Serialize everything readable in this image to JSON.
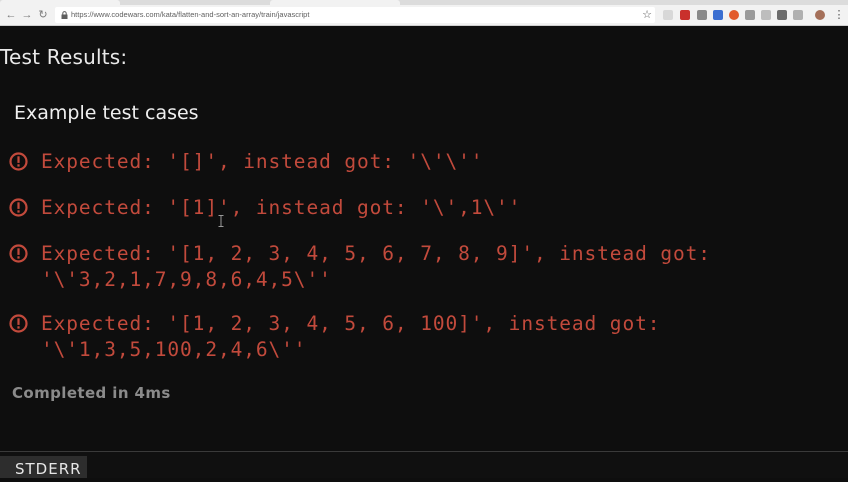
{
  "browser": {
    "url": "https://www.codewars.com/kata/flatten-and-sort-an-array/train/javascript",
    "nav_icons": [
      "back-arrow-icon",
      "forward-arrow-icon",
      "reload-icon"
    ],
    "extension_icons": [
      "star-icon",
      "extension-icon",
      "extension-icon",
      "extension-icon",
      "extension-icon",
      "extension-icon",
      "extension-icon",
      "extension-icon",
      "extension-icon",
      "extension-icon",
      "profile-avatar",
      "menu-icon"
    ]
  },
  "results": {
    "title": "Test Results:",
    "section_title": "Example test cases",
    "failures": [
      {
        "icon": "error-circle-icon",
        "message": "Expected: '[]', instead got: '\\'\\''"
      },
      {
        "icon": "error-circle-icon",
        "message": "Expected: '[1]', instead got: '\\',1\\''"
      },
      {
        "icon": "error-circle-icon",
        "message": "Expected: '[1, 2, 3, 4, 5, 6, 7, 8, 9]', instead got:\n'\\'3,2,1,7,9,8,6,4,5\\''"
      },
      {
        "icon": "error-circle-icon",
        "message": "Expected: '[1, 2, 3, 4, 5, 6, 100]', instead got:\n'\\'1,3,5,100,2,4,6\\''"
      }
    ],
    "completed": "Completed in 4ms"
  },
  "bottom_bar": {
    "stderr_label": "STDERR"
  },
  "colors": {
    "background": "#0e0e0e",
    "error_red": "#c24a3c",
    "heading_text": "#e9e9e9",
    "muted_text": "#8b8b8b"
  }
}
